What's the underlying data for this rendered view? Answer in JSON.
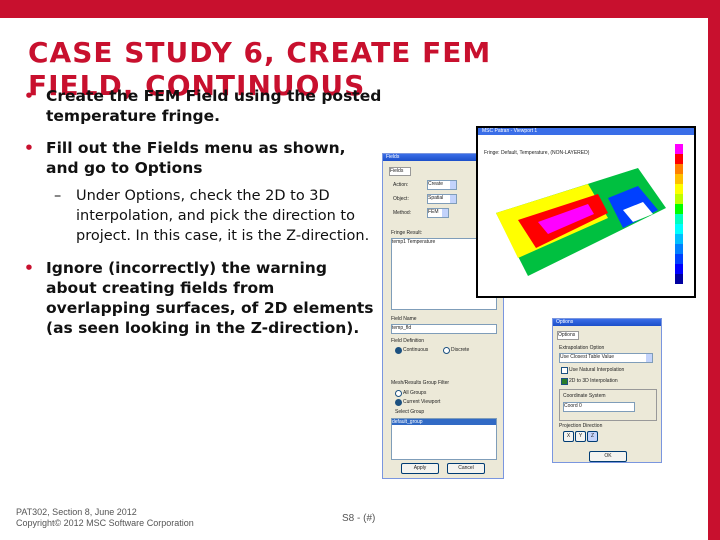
{
  "slide": {
    "title": "CASE STUDY 6, CREATE FEM FIELD, CONTINUOUS",
    "bullets": [
      {
        "text": "Create the FEM Field using the posted temperature fringe."
      },
      {
        "text": "Fill out the Fields menu as shown, and go to Options",
        "sub": "Under Options, check the 2D to 3D interpolation, and pick the direction to project. In this case, it is the Z-direction."
      },
      {
        "text": "Ignore (incorrectly) the warning about creating fields from overlapping surfaces, of 2D elements (as seen looking in the Z-direction)."
      }
    ],
    "footer_line1": "PAT302, Section 8, June 2012",
    "footer_line2": "Copyright© 2012 MSC Software Corporation",
    "page_label": "S8 - (#)"
  },
  "colors": {
    "accent": "#c8102e"
  },
  "fields_dialog": {
    "title": "Fields",
    "labels": [
      "Action:",
      "Object:",
      "Method:"
    ],
    "values": [
      "Create",
      "Spatial",
      "FEM"
    ],
    "list_header": "Fringe Result:",
    "list_item": "temp1 Temperature",
    "name_label": "Field Name",
    "name_value": "temp_fld",
    "interp_header": "Field Definition",
    "radio1": "Continuous",
    "radio2": "Discrete",
    "group_header": "Mesh/Results Group Filter",
    "group_options": [
      "All Groups",
      "Current Viewport",
      "Select Group"
    ],
    "group_item": "default_group",
    "btn_apply": "Apply",
    "btn_cancel": "Cancel"
  },
  "options_dialog": {
    "title": "Options",
    "extrap_label": "Extrapolation Option",
    "extrap_value": "Use Closest Table Value",
    "check1": "Use Natural Interpolation",
    "check2": "2D to 3D Interpolation",
    "coord_label": "Coordinate System",
    "coord_value": "Coord 0",
    "dir_label": "Projection Direction",
    "dirs": [
      "X",
      "Y",
      "Z"
    ],
    "btn_ok": "OK"
  },
  "plot": {
    "titlebar": "MSC Patran - Viewport 1",
    "caption": "Fringe: Default, Temperature, (NON-LAYERED)",
    "legend_colors": [
      "#ff00ff",
      "#ff0000",
      "#ff7f00",
      "#ffbf00",
      "#ffff00",
      "#bfff00",
      "#00ff00",
      "#00ffbf",
      "#00ffff",
      "#00bfff",
      "#0080ff",
      "#0040ff",
      "#0000ff",
      "#0000a0"
    ]
  }
}
